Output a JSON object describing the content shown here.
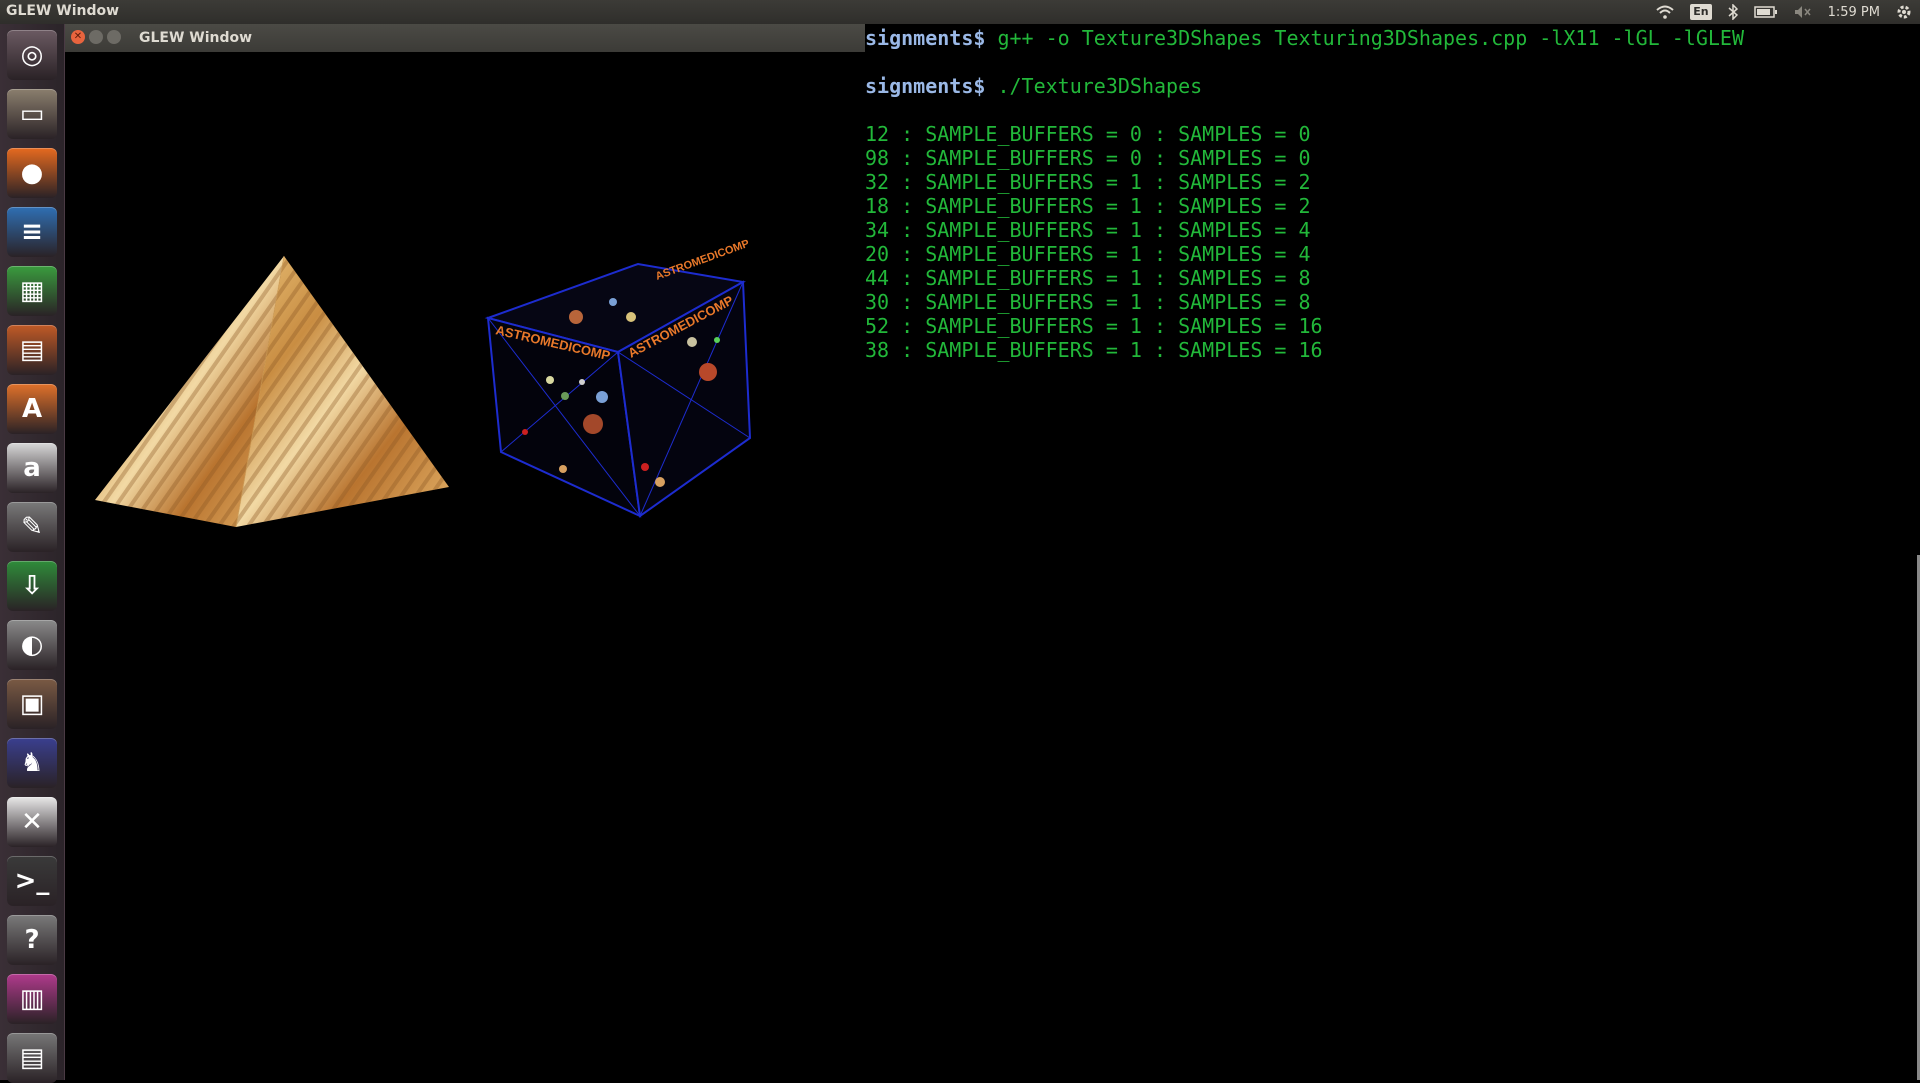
{
  "top_panel": {
    "app_title": "GLEW Window",
    "language": "En",
    "clock": "1:59 PM",
    "icons": [
      "wifi-icon",
      "keyboard-language-icon",
      "bluetooth-icon",
      "battery-icon",
      "volume-muted-icon",
      "settings-gear-icon"
    ]
  },
  "launcher": {
    "items": [
      {
        "name": "ubuntu-dash",
        "glyph": "◎",
        "color": "#6b5a62"
      },
      {
        "name": "files",
        "glyph": "▭",
        "color": "#8b7f6e"
      },
      {
        "name": "firefox",
        "glyph": "●",
        "color": "#e66a1f"
      },
      {
        "name": "writer",
        "glyph": "≡",
        "color": "#2f6fb3"
      },
      {
        "name": "calc",
        "glyph": "▦",
        "color": "#3a9c3e"
      },
      {
        "name": "impress",
        "glyph": "▤",
        "color": "#c05a26"
      },
      {
        "name": "software-center",
        "glyph": "A",
        "color": "#e0712a"
      },
      {
        "name": "amazon",
        "glyph": "a",
        "color": "#d8d8d8"
      },
      {
        "name": "system-settings",
        "glyph": "✎",
        "color": "#7a7a7a"
      },
      {
        "name": "terminal-download",
        "glyph": "⇩",
        "color": "#2f8c3a"
      },
      {
        "name": "sphere-app",
        "glyph": "◐",
        "color": "#8a8a8a"
      },
      {
        "name": "archive",
        "glyph": "▣",
        "color": "#7a5a44"
      },
      {
        "name": "horse-app",
        "glyph": "♞",
        "color": "#3a3f8f"
      },
      {
        "name": "graph-calc",
        "glyph": "✕",
        "color": "#e8e8e8"
      },
      {
        "name": "terminal",
        "glyph": ">_",
        "color": "#3a3a3a"
      },
      {
        "name": "help",
        "glyph": "?",
        "color": "#7a7a7a"
      },
      {
        "name": "workspace-switcher",
        "glyph": "▥",
        "color": "#b03a8c"
      },
      {
        "name": "trash",
        "glyph": "▤",
        "color": "#777777"
      }
    ]
  },
  "glew_window": {
    "title": "GLEW Window",
    "cube_text": [
      "ASTROMEDICOMP",
      "ASTROMEDICOMP",
      "ASTROMEDICOMP"
    ]
  },
  "terminal": {
    "cmd1_prompt": "signments$",
    "cmd1_text": " g++ -o Texture3DShapes Texturing3DShapes.cpp -lX11 -lGL -lGLEW",
    "cmd2_prompt": "signments$",
    "cmd2_text": " ./Texture3DShapes",
    "output": [
      "12 : SAMPLE_BUFFERS = 0 : SAMPLES = 0",
      "98 : SAMPLE_BUFFERS = 0 : SAMPLES = 0",
      "32 : SAMPLE_BUFFERS = 1 : SAMPLES = 2",
      "18 : SAMPLE_BUFFERS = 1 : SAMPLES = 2",
      "34 : SAMPLE_BUFFERS = 1 : SAMPLES = 4",
      "20 : SAMPLE_BUFFERS = 1 : SAMPLES = 4",
      "44 : SAMPLE_BUFFERS = 1 : SAMPLES = 8",
      "30 : SAMPLE_BUFFERS = 1 : SAMPLES = 8",
      "52 : SAMPLE_BUFFERS = 1 : SAMPLES = 16",
      "38 : SAMPLE_BUFFERS = 1 : SAMPLES = 16"
    ]
  }
}
